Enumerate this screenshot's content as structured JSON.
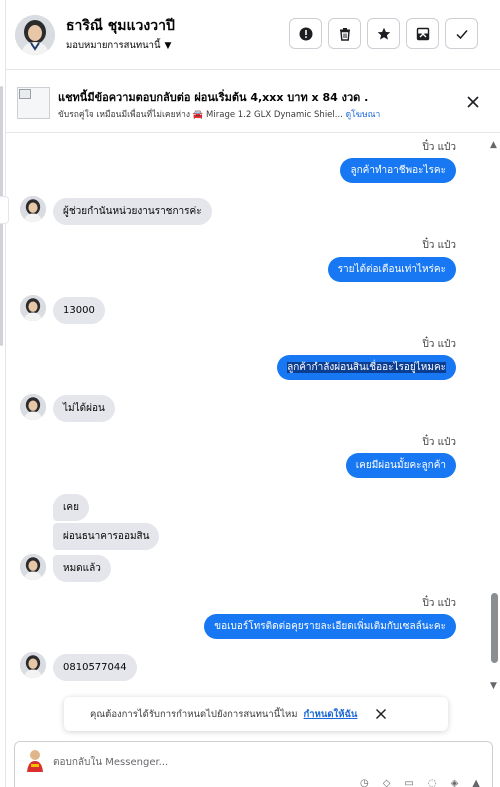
{
  "header": {
    "contact_name": "ธาริณี ชุมแวงวาปี",
    "assign_label": "มอบหมายการสนทนานี้",
    "actions": [
      "report",
      "delete",
      "star",
      "archive",
      "done"
    ]
  },
  "ad_banner": {
    "title": "แชทนี้มีข้อความตอบกลับต่อ ผ่อนเริ่มต้น 4,xxx บาท x 84 งวด .",
    "subtitle": "ขับรถคู่ใจ เหมือนมีเพื่อนที่ไม่เคยห่าง 🚘 Mirage 1.2 GLX Dynamic Shiel...",
    "link": "ดูโฆษณา"
  },
  "messages": [
    {
      "dir": "out",
      "sender": "ปิ๋ว แป๋ว",
      "text": "ลูกค้าทำอาชีพอะไรคะ"
    },
    {
      "dir": "in",
      "text": "ผู้ช่วยกำนันหน่วยงานราชการค่ะ"
    },
    {
      "dir": "out",
      "sender": "ปิ๋ว แป๋ว",
      "text": "รายได้ต่อเดือนเท่าไหร่คะ"
    },
    {
      "dir": "in",
      "text": "13000"
    },
    {
      "dir": "out",
      "sender": "ปิ๋ว แป๋ว",
      "text": "ลูกค้ากำลังผ่อนสินเชื่ออะไรอยู่ไหมคะ"
    },
    {
      "dir": "in",
      "text": "ไม่ได้ผ่อน"
    },
    {
      "dir": "out",
      "sender": "ปิ๋ว แป๋ว",
      "text": "เคยมีผ่อนมั้ยคะลูกค้า"
    },
    {
      "dir": "in",
      "text": "เคย"
    },
    {
      "dir": "in",
      "text": "ผ่อนธนาคารออมสิน"
    },
    {
      "dir": "in",
      "text": "หมดแล้ว"
    },
    {
      "dir": "out",
      "sender": "ปิ๋ว แป๋ว",
      "text": "ขอเบอร์โทรติดต่อคุยรายละเอียดเพิ่มเติมกับเซลล์นะคะ"
    },
    {
      "dir": "in",
      "text": "0810577044"
    }
  ],
  "notice": {
    "text": "คุณต้องการได้รับการกำหนดไปยังการสนทนานี้ไหม",
    "cta": "กำหนดให้ฉัน"
  },
  "composer": {
    "placeholder": "ตอบกลับใน Messenger..."
  },
  "colors": {
    "outgoing_bubble": "#1877f2",
    "incoming_bubble": "#e4e6eb",
    "link": "#1a66d6"
  }
}
